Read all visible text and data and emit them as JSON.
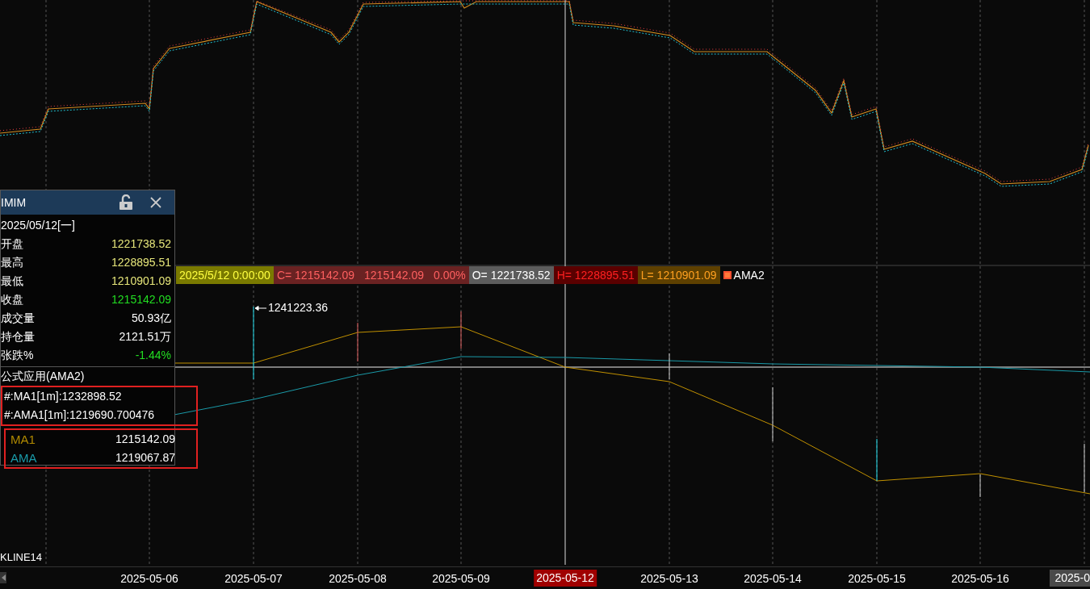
{
  "popup": {
    "title": "IMIM",
    "date": "2025/05/12[一]",
    "rows": [
      {
        "label": "开盘",
        "value": "1221738.52",
        "color": "#e6e67a"
      },
      {
        "label": "最高",
        "value": "1228895.51",
        "color": "#e6e67a"
      },
      {
        "label": "最低",
        "value": "1210901.09",
        "color": "#e6e67a"
      },
      {
        "label": "收盘",
        "value": "1215142.09",
        "color": "#22dd22"
      },
      {
        "label": "成交量",
        "value": "50.93亿",
        "color": "#ffffff"
      },
      {
        "label": "持仓量",
        "value": "2121.51万",
        "color": "#ffffff"
      },
      {
        "label": "张跌%",
        "value": "-1.44%",
        "color": "#22dd22"
      }
    ],
    "formula": {
      "title": "公式应用(AMA2)",
      "params": [
        "#:MA1[1m]:1232898.52",
        "#:AMA1[1m]:1219690.700476"
      ],
      "lines": [
        {
          "name": "MA1",
          "value": "1215142.09",
          "color": "#b08a00"
        },
        {
          "name": "AMA",
          "value": "1219067.87",
          "color": "#1a9aa8"
        }
      ]
    }
  },
  "info_bar": {
    "items": [
      {
        "kind": "date",
        "texts": [
          "2025/5/12 0:00:00"
        ]
      },
      {
        "kind": "close",
        "texts": [
          "C= 1215142.09",
          "1215142.09",
          "0.00%"
        ]
      },
      {
        "kind": "open",
        "texts": [
          "O= 1221738.52"
        ]
      },
      {
        "kind": "high",
        "texts": [
          "H= 1228895.51"
        ]
      },
      {
        "kind": "low",
        "texts": [
          "L= 1210901.09"
        ]
      }
    ],
    "indicator": "AMA2"
  },
  "peak_label": "1241223.36",
  "pane_label": "KLINE14",
  "dates": [
    {
      "text": "2025-05-06",
      "kind": "tick"
    },
    {
      "text": "2025-05-07",
      "kind": "tick"
    },
    {
      "text": "2025-05-08",
      "kind": "tick"
    },
    {
      "text": "2025-05-09",
      "kind": "tick"
    },
    {
      "text": "2025-05-12",
      "kind": "cursor"
    },
    {
      "text": "2025-05-13",
      "kind": "tick"
    },
    {
      "text": "2025-05-14",
      "kind": "tick"
    },
    {
      "text": "2025-05-15",
      "kind": "tick"
    },
    {
      "text": "2025-05-16",
      "kind": "tick"
    },
    {
      "text": "2025-0",
      "kind": "edge"
    }
  ]
}
